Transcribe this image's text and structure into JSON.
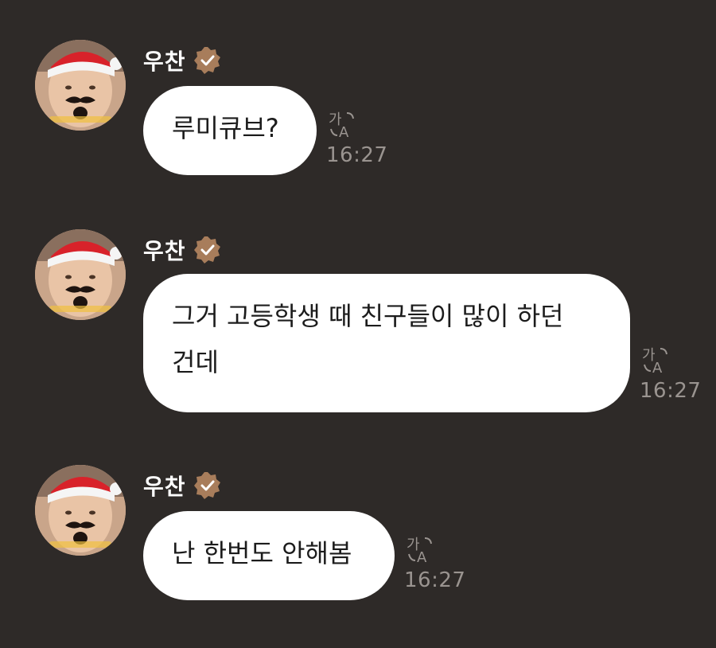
{
  "colors": {
    "background": "#2e2a28",
    "bubble": "#ffffff",
    "bubble_text": "#1c1c1c",
    "name_text": "#ffffff",
    "timestamp_text": "#9a9490",
    "verified_badge": "#a87d5b"
  },
  "messages": [
    {
      "sender": "우찬",
      "text": "루미큐브?",
      "time": "16:27",
      "avatar_icon": "profile-photo-santa-hat",
      "verified_icon": "verified-check-badge-icon",
      "translate_icon": "translate-icon"
    },
    {
      "sender": "우찬",
      "text": "그거 고등학생 때 친구들이 많이 하던\n건데",
      "time": "16:27",
      "avatar_icon": "profile-photo-santa-hat",
      "verified_icon": "verified-check-badge-icon",
      "translate_icon": "translate-icon"
    },
    {
      "sender": "우찬",
      "text": "난 한번도 안해봄",
      "time": "16:27",
      "avatar_icon": "profile-photo-santa-hat",
      "verified_icon": "verified-check-badge-icon",
      "translate_icon": "translate-icon"
    }
  ]
}
